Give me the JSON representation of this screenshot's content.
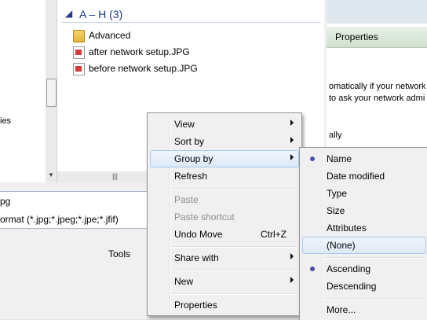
{
  "properties_window": {
    "title": "Properties",
    "text_lines": [
      "omatically if your network",
      "to ask your network admi",
      "ally"
    ]
  },
  "nav_pane": {
    "partial_label": "ies"
  },
  "file_list": {
    "group_header": "A – H (3)",
    "items": [
      {
        "name": "Advanced",
        "type": "folder"
      },
      {
        "name": "after network setup.JPG",
        "type": "image"
      },
      {
        "name": "before network setup.JPG",
        "type": "image"
      }
    ]
  },
  "file_name_field": {
    "value": "pg"
  },
  "file_type_field": {
    "value": "ormat (*.jpg;*.jpeg;*.jpe;*.jfif)"
  },
  "tools_button": {
    "label": "Tools"
  },
  "context_menu": {
    "view": "View",
    "sort_by": "Sort by",
    "group_by": "Group by",
    "refresh": "Refresh",
    "paste": "Paste",
    "paste_shortcut": "Paste shortcut",
    "undo_move": "Undo Move",
    "undo_shortcut": "Ctrl+Z",
    "share_with": "Share with",
    "new": "New",
    "properties": "Properties"
  },
  "group_by_menu": {
    "name": "Name",
    "date_modified": "Date modified",
    "type": "Type",
    "size": "Size",
    "attributes": "Attributes",
    "none": "(None)",
    "ascending": "Ascending",
    "descending": "Descending",
    "more": "More...",
    "selected_group": "Name",
    "selected_order": "Ascending"
  }
}
